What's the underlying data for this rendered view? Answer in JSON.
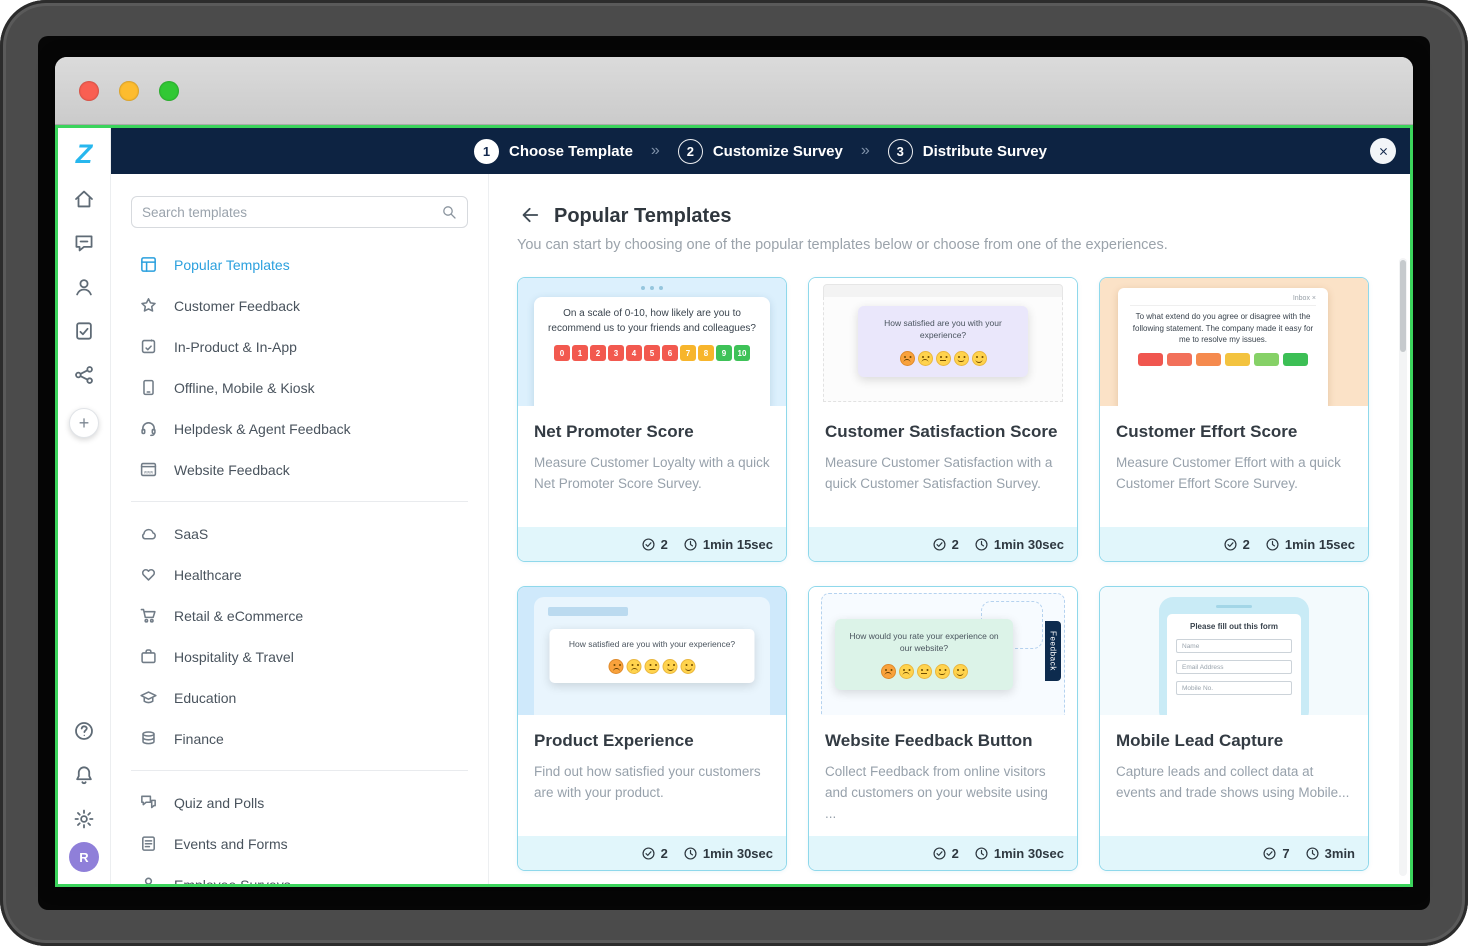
{
  "window": {
    "traffic_lights": [
      {
        "name": "close",
        "color": "#f95f52"
      },
      {
        "name": "minimize",
        "color": "#fdbc2f"
      },
      {
        "name": "zoom",
        "color": "#31c835"
      }
    ]
  },
  "topbar": {
    "separator": "»",
    "steps": [
      {
        "num": "1",
        "label": "Choose Template",
        "active": true
      },
      {
        "num": "2",
        "label": "Customize Survey",
        "active": false
      },
      {
        "num": "3",
        "label": "Distribute Survey",
        "active": false
      }
    ]
  },
  "rail": {
    "logo_text": "Z",
    "top_items": [
      {
        "icon": "home"
      },
      {
        "icon": "feedback-chat"
      },
      {
        "icon": "contacts"
      },
      {
        "icon": "survey-tasks"
      },
      {
        "icon": "integrations"
      }
    ],
    "plus_label": "+",
    "bottom_items": [
      {
        "icon": "help"
      },
      {
        "icon": "notifications"
      },
      {
        "icon": "settings"
      }
    ],
    "avatar_text": "R"
  },
  "sidebar": {
    "search_placeholder": "Search templates",
    "groups": [
      {
        "items": [
          {
            "label": "Popular Templates",
            "icon": "templates",
            "active": true
          },
          {
            "label": "Customer Feedback",
            "icon": "star",
            "active": false
          },
          {
            "label": "In-Product & In-App",
            "icon": "in-app",
            "active": false
          },
          {
            "label": "Offline, Mobile & Kiosk",
            "icon": "kiosk",
            "active": false
          },
          {
            "label": "Helpdesk & Agent Feedback",
            "icon": "headset",
            "active": false
          },
          {
            "label": "Website Feedback",
            "icon": "website",
            "active": false
          }
        ]
      },
      {
        "items": [
          {
            "label": "SaaS",
            "icon": "cloud",
            "active": false
          },
          {
            "label": "Healthcare",
            "icon": "healthcare",
            "active": false
          },
          {
            "label": "Retail & eCommerce",
            "icon": "cart",
            "active": false
          },
          {
            "label": "Hospitality & Travel",
            "icon": "travel",
            "active": false
          },
          {
            "label": "Education",
            "icon": "education",
            "active": false
          },
          {
            "label": "Finance",
            "icon": "finance",
            "active": false
          }
        ]
      },
      {
        "items": [
          {
            "label": "Quiz and Polls",
            "icon": "quiz",
            "active": false
          },
          {
            "label": "Events and Forms",
            "icon": "events",
            "active": false
          },
          {
            "label": "Employee Surveys",
            "icon": "employee",
            "active": false
          }
        ]
      }
    ]
  },
  "main": {
    "title": "Popular Templates",
    "subtitle": "You can start by choosing one of the popular templates below or choose from one of the experiences.",
    "cards": [
      {
        "title": "Net Promoter Score",
        "desc": "Measure Customer Loyalty with a quick Net Promoter Score Survey.",
        "responses": "2",
        "time": "1min 15sec",
        "thumb": {
          "type": "nps",
          "question": "On a scale of 0-10, how likely are you to recommend us to your friends and colleagues?",
          "scale_labels": [
            "0",
            "1",
            "2",
            "3",
            "4",
            "5",
            "6",
            "7",
            "8",
            "9",
            "10"
          ],
          "scale_colors": [
            "#f2594f",
            "#f2594f",
            "#f2594f",
            "#f2594f",
            "#f2594f",
            "#f2594f",
            "#f2594f",
            "#f7b52c",
            "#f7b52c",
            "#3ec258",
            "#3ec258"
          ]
        }
      },
      {
        "title": "Customer Satisfaction Score",
        "desc": "Measure Customer Satisfaction with a quick Customer Satisfaction Survey.",
        "responses": "2",
        "time": "1min 30sec",
        "thumb": {
          "type": "emoji",
          "style": "csat",
          "panel_bg": "#eae7fb",
          "question": "How satisfied are you with your experience?",
          "moods": [
            "angry",
            "sad",
            "neutral",
            "smile",
            "happy"
          ]
        }
      },
      {
        "title": "Customer Effort Score",
        "desc": "Measure Customer Effort with a quick Customer Effort Score Survey.",
        "responses": "2",
        "time": "1min 15sec",
        "thumb": {
          "type": "ces",
          "tab_label": "Inbox ×",
          "question": "To what extend do you agree or disagree with the following statement. The company made it easy for me to resolve my issues.",
          "scale_colors": [
            "#f0564f",
            "#f2705a",
            "#f58a4e",
            "#f3c33f",
            "#86d167",
            "#3cbf55"
          ]
        }
      },
      {
        "title": "Product Experience",
        "desc": "Find out how satisfied your customers are with your product.",
        "responses": "2",
        "time": "1min 30sec",
        "thumb": {
          "type": "emoji",
          "style": "pe",
          "panel_bg": "#ffffff",
          "question": "How satisfied are you with your experience?",
          "moods": [
            "angry",
            "sad",
            "neutral",
            "smile",
            "happy"
          ]
        }
      },
      {
        "title": "Website Feedback Button",
        "desc": "Collect Feedback from online visitors and customers on your website using ...",
        "responses": "2",
        "time": "1min 30sec",
        "thumb": {
          "type": "emoji",
          "style": "wfb",
          "panel_bg": "#dcf3e8",
          "question": "How would you rate your experience on our website?",
          "moods": [
            "angry",
            "sad",
            "neutral",
            "smile",
            "happy"
          ],
          "side_tab": "Feedback"
        }
      },
      {
        "title": "Mobile Lead Capture",
        "desc": "Capture leads and collect data at events and trade shows using Mobile...",
        "responses": "7",
        "time": "3min",
        "thumb": {
          "type": "mobile-form",
          "form_title": "Please fill out this form",
          "fields": [
            "Name",
            "Email Address",
            "Mobile No."
          ]
        }
      }
    ]
  },
  "colors": {
    "navbar_bg": "#0d2342",
    "app_border": "#3bd45c",
    "accent_blue": "#2ba0de",
    "card_border": "#8fd8eb",
    "card_footer_bg": "#e1f6fb",
    "logo_cyan": "#27b7ee",
    "avatar_purple": "#8f7fd9"
  }
}
